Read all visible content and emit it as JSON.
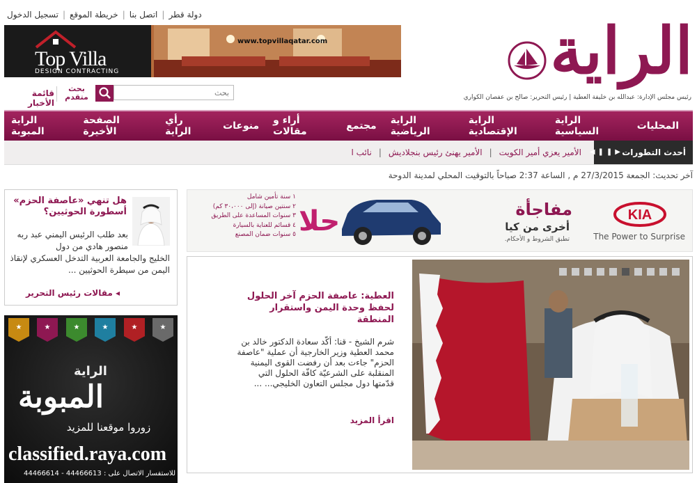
{
  "top_links": {
    "qatar": "دولة قطر",
    "contact": "اتصل بنا",
    "sitemap": "خريطة الموقع",
    "login": "تسجيل الدخول"
  },
  "banner": {
    "brand": "Top Villa",
    "brand_sub": "DESIGN CONTRACTING",
    "url": "www.topvillaqatar.com"
  },
  "logo": {
    "text": "الراية",
    "credits": "رئيس مجلس الإدارة: عبدالله بن خليفة العطية | رئيس التحرير: صالح بن عفصان الكواري"
  },
  "search": {
    "placeholder": "بحث",
    "advanced_label": "بحث متقدم",
    "news_list_label": "قائمة الأخبار"
  },
  "nav": {
    "items": [
      "المحليات",
      "الراية السياسية",
      "الراية الإقتصادية",
      "الراية الرياضية",
      "مجتمع",
      "أراء و مقالات",
      "منوعات",
      "رأي الراية",
      "الصفحة الأخيرة",
      "الراية المبوبة"
    ]
  },
  "ticker": {
    "label": "أحدث التطورات",
    "items": [
      "الأمير يعزي أمير الكويت",
      "الأمير يهنئ رئيس بنجلاديش",
      "نائب ا"
    ]
  },
  "update_text": "آخر تحديث: الجمعة 27/3/2015 م , الساعة 2:37 صباحاً بالتوقيت المحلي لمدينة الدوحة",
  "opinion": {
    "title": "هل تنهي «عاصفة الحزم» أسطورة الحوثيين؟",
    "body": "بعد طلب الرئيس اليمني عبد ربه منصور هادي من دول",
    "body2": "الخليج والجامعة العربية التدخل العسكري لإنقاذ اليمن من سيطرة الحوثيين ...",
    "more": "مقالات رئيس التحرير"
  },
  "classified": {
    "raya": "الراية",
    "title": "المبوبة",
    "visit": "زوروا موقعنا للمزيد",
    "url": "classified.raya.com",
    "phone": "للاستفسار الاتصال على : 44466613 - 44466614"
  },
  "kia": {
    "logo": "KIA",
    "tagline": "The Power to Surprise",
    "headline": "مفاجأة",
    "subhead": "أخرى من كيا",
    "terms": "تطبق الشروط و الأحكام.",
    "hala": "حلا",
    "bullets": [
      "١ سنة تأمين شامل",
      "٢ سنتين صيانة (إلى ٣٠،٠٠٠ كم)",
      "٣ سنوات المساعدة على الطريق",
      "٤ قسائم للعناية بالسيارة",
      "٥ سنوات ضمان المصنع"
    ]
  },
  "feature": {
    "title": "العطية: عاصفة الحزم آخر الحلول لحفظ وحدة اليمن واستقرار المنطقة",
    "body": "شرم الشيخ - قنا: أكّد سعادة الدكتور خالد بن محمد العطية وزير الخارجية أن عملية \"عاصفة الحزم\" جاءت بعد أن رفضت القوى اليمنية المنقلبة على الشرعيّة كافّة الحلول التي قدّمتها دول مجلس التعاون الخليجي... ...",
    "more": "اقرأ المزيد",
    "slides": 10,
    "active_slide": 5
  },
  "colors": {
    "brand": "#8e1852",
    "nav_bg": "#7a0f43"
  }
}
